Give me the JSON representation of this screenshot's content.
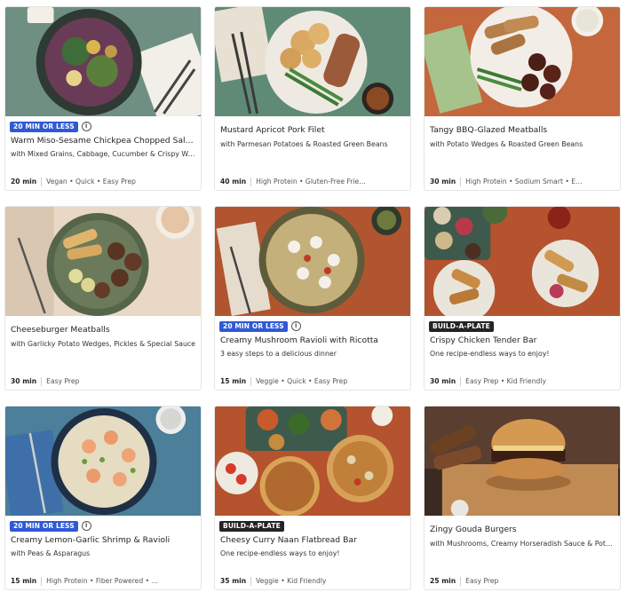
{
  "cards": [
    {
      "badge": "20 MIN OR LESS",
      "title": "Warm Miso-Sesame Chickpea Chopped Sal…",
      "subtitle": "with Mixed Grains, Cabbage, Cucumber & Crispy Wo…",
      "time": "20 min",
      "tags": "Vegan • Quick • Easy Prep",
      "bg": "#6f8f83"
    },
    {
      "title": "Mustard Apricot Pork Filet",
      "subtitle": "with Parmesan Potatoes & Roasted Green Beans",
      "time": "40 min",
      "tags": "High Protein • Gluten-Free Frie…",
      "bg": "#5f8b76"
    },
    {
      "title": "Tangy BBQ-Glazed Meatballs",
      "subtitle": "with Potato Wedges & Roasted Green Beans",
      "time": "30 min",
      "tags": "High Protein • Sodium Smart • E…",
      "bg": "#c4673d"
    },
    {
      "title": "Cheeseburger Meatballs",
      "subtitle": "with Garlicky Potato Wedges, Pickles & Special Sauce",
      "time": "30 min",
      "tags": "Easy Prep",
      "bg": "#ead8c6"
    },
    {
      "badge": "20 MIN OR LESS",
      "title": "Creamy Mushroom Ravioli with Ricotta",
      "subtitle": "3 easy steps to a delicious dinner",
      "time": "15 min",
      "tags": "Veggie • Quick • Easy Prep",
      "bg": "#b0552f"
    },
    {
      "badge": "BUILD-A-PLATE",
      "title": "Crispy Chicken Tender Bar",
      "subtitle": "One recipe-endless ways to enjoy!",
      "time": "30 min",
      "tags": "Easy Prep • Kid Friendly",
      "bg": "#b4532e"
    },
    {
      "badge": "20 MIN OR LESS",
      "title": "Creamy Lemon-Garlic Shrimp & Ravioli",
      "subtitle": "with Peas & Asparagus",
      "time": "15 min",
      "tags": "High Protein • Fiber Powered • …",
      "bg": "#4c7f99"
    },
    {
      "badge": "BUILD-A-PLATE",
      "title": "Cheesy Curry Naan Flatbread Bar",
      "subtitle": "One recipe-endless ways to enjoy!",
      "time": "35 min",
      "tags": "Veggie • Kid Friendly",
      "bg": "#b4532e"
    },
    {
      "title": "Zingy Gouda Burgers",
      "subtitle": "with Mushrooms, Creamy Horseradish Sauce & Potat…",
      "time": "25 min",
      "tags": "Easy Prep",
      "bg": "#3a2a22"
    }
  ]
}
